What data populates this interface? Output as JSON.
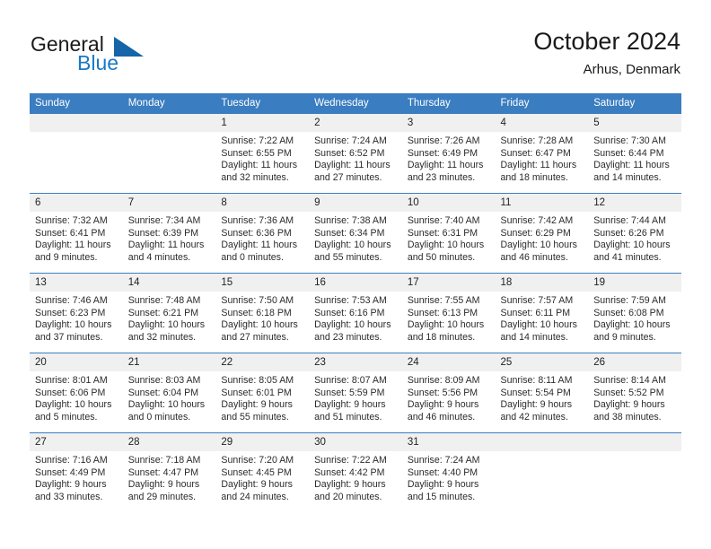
{
  "brand": {
    "name_part1": "General",
    "name_part2": "Blue",
    "accent_color": "#1a79c4",
    "triangle_color": "#1565a8"
  },
  "header": {
    "title": "October 2024",
    "subtitle": "Arhus, Denmark"
  },
  "theme": {
    "header_row_bg": "#3a7dc0",
    "day_number_bg": "#f0f0f0",
    "grid_line": "#3a7dc0",
    "text": "#222222"
  },
  "weekdays": [
    "Sunday",
    "Monday",
    "Tuesday",
    "Wednesday",
    "Thursday",
    "Friday",
    "Saturday"
  ],
  "labels": {
    "sunrise_prefix": "Sunrise:",
    "sunset_prefix": "Sunset:",
    "daylight_prefix": "Daylight:"
  },
  "weeks": [
    [
      {
        "day": "",
        "blank": true
      },
      {
        "day": "",
        "blank": true
      },
      {
        "day": "1",
        "sunrise": "Sunrise: 7:22 AM",
        "sunset": "Sunset: 6:55 PM",
        "daylight_line1": "Daylight: 11 hours",
        "daylight_line2": "and 32 minutes."
      },
      {
        "day": "2",
        "sunrise": "Sunrise: 7:24 AM",
        "sunset": "Sunset: 6:52 PM",
        "daylight_line1": "Daylight: 11 hours",
        "daylight_line2": "and 27 minutes."
      },
      {
        "day": "3",
        "sunrise": "Sunrise: 7:26 AM",
        "sunset": "Sunset: 6:49 PM",
        "daylight_line1": "Daylight: 11 hours",
        "daylight_line2": "and 23 minutes."
      },
      {
        "day": "4",
        "sunrise": "Sunrise: 7:28 AM",
        "sunset": "Sunset: 6:47 PM",
        "daylight_line1": "Daylight: 11 hours",
        "daylight_line2": "and 18 minutes."
      },
      {
        "day": "5",
        "sunrise": "Sunrise: 7:30 AM",
        "sunset": "Sunset: 6:44 PM",
        "daylight_line1": "Daylight: 11 hours",
        "daylight_line2": "and 14 minutes."
      }
    ],
    [
      {
        "day": "6",
        "sunrise": "Sunrise: 7:32 AM",
        "sunset": "Sunset: 6:41 PM",
        "daylight_line1": "Daylight: 11 hours",
        "daylight_line2": "and 9 minutes."
      },
      {
        "day": "7",
        "sunrise": "Sunrise: 7:34 AM",
        "sunset": "Sunset: 6:39 PM",
        "daylight_line1": "Daylight: 11 hours",
        "daylight_line2": "and 4 minutes."
      },
      {
        "day": "8",
        "sunrise": "Sunrise: 7:36 AM",
        "sunset": "Sunset: 6:36 PM",
        "daylight_line1": "Daylight: 11 hours",
        "daylight_line2": "and 0 minutes."
      },
      {
        "day": "9",
        "sunrise": "Sunrise: 7:38 AM",
        "sunset": "Sunset: 6:34 PM",
        "daylight_line1": "Daylight: 10 hours",
        "daylight_line2": "and 55 minutes."
      },
      {
        "day": "10",
        "sunrise": "Sunrise: 7:40 AM",
        "sunset": "Sunset: 6:31 PM",
        "daylight_line1": "Daylight: 10 hours",
        "daylight_line2": "and 50 minutes."
      },
      {
        "day": "11",
        "sunrise": "Sunrise: 7:42 AM",
        "sunset": "Sunset: 6:29 PM",
        "daylight_line1": "Daylight: 10 hours",
        "daylight_line2": "and 46 minutes."
      },
      {
        "day": "12",
        "sunrise": "Sunrise: 7:44 AM",
        "sunset": "Sunset: 6:26 PM",
        "daylight_line1": "Daylight: 10 hours",
        "daylight_line2": "and 41 minutes."
      }
    ],
    [
      {
        "day": "13",
        "sunrise": "Sunrise: 7:46 AM",
        "sunset": "Sunset: 6:23 PM",
        "daylight_line1": "Daylight: 10 hours",
        "daylight_line2": "and 37 minutes."
      },
      {
        "day": "14",
        "sunrise": "Sunrise: 7:48 AM",
        "sunset": "Sunset: 6:21 PM",
        "daylight_line1": "Daylight: 10 hours",
        "daylight_line2": "and 32 minutes."
      },
      {
        "day": "15",
        "sunrise": "Sunrise: 7:50 AM",
        "sunset": "Sunset: 6:18 PM",
        "daylight_line1": "Daylight: 10 hours",
        "daylight_line2": "and 27 minutes."
      },
      {
        "day": "16",
        "sunrise": "Sunrise: 7:53 AM",
        "sunset": "Sunset: 6:16 PM",
        "daylight_line1": "Daylight: 10 hours",
        "daylight_line2": "and 23 minutes."
      },
      {
        "day": "17",
        "sunrise": "Sunrise: 7:55 AM",
        "sunset": "Sunset: 6:13 PM",
        "daylight_line1": "Daylight: 10 hours",
        "daylight_line2": "and 18 minutes."
      },
      {
        "day": "18",
        "sunrise": "Sunrise: 7:57 AM",
        "sunset": "Sunset: 6:11 PM",
        "daylight_line1": "Daylight: 10 hours",
        "daylight_line2": "and 14 minutes."
      },
      {
        "day": "19",
        "sunrise": "Sunrise: 7:59 AM",
        "sunset": "Sunset: 6:08 PM",
        "daylight_line1": "Daylight: 10 hours",
        "daylight_line2": "and 9 minutes."
      }
    ],
    [
      {
        "day": "20",
        "sunrise": "Sunrise: 8:01 AM",
        "sunset": "Sunset: 6:06 PM",
        "daylight_line1": "Daylight: 10 hours",
        "daylight_line2": "and 5 minutes."
      },
      {
        "day": "21",
        "sunrise": "Sunrise: 8:03 AM",
        "sunset": "Sunset: 6:04 PM",
        "daylight_line1": "Daylight: 10 hours",
        "daylight_line2": "and 0 minutes."
      },
      {
        "day": "22",
        "sunrise": "Sunrise: 8:05 AM",
        "sunset": "Sunset: 6:01 PM",
        "daylight_line1": "Daylight: 9 hours",
        "daylight_line2": "and 55 minutes."
      },
      {
        "day": "23",
        "sunrise": "Sunrise: 8:07 AM",
        "sunset": "Sunset: 5:59 PM",
        "daylight_line1": "Daylight: 9 hours",
        "daylight_line2": "and 51 minutes."
      },
      {
        "day": "24",
        "sunrise": "Sunrise: 8:09 AM",
        "sunset": "Sunset: 5:56 PM",
        "daylight_line1": "Daylight: 9 hours",
        "daylight_line2": "and 46 minutes."
      },
      {
        "day": "25",
        "sunrise": "Sunrise: 8:11 AM",
        "sunset": "Sunset: 5:54 PM",
        "daylight_line1": "Daylight: 9 hours",
        "daylight_line2": "and 42 minutes."
      },
      {
        "day": "26",
        "sunrise": "Sunrise: 8:14 AM",
        "sunset": "Sunset: 5:52 PM",
        "daylight_line1": "Daylight: 9 hours",
        "daylight_line2": "and 38 minutes."
      }
    ],
    [
      {
        "day": "27",
        "sunrise": "Sunrise: 7:16 AM",
        "sunset": "Sunset: 4:49 PM",
        "daylight_line1": "Daylight: 9 hours",
        "daylight_line2": "and 33 minutes."
      },
      {
        "day": "28",
        "sunrise": "Sunrise: 7:18 AM",
        "sunset": "Sunset: 4:47 PM",
        "daylight_line1": "Daylight: 9 hours",
        "daylight_line2": "and 29 minutes."
      },
      {
        "day": "29",
        "sunrise": "Sunrise: 7:20 AM",
        "sunset": "Sunset: 4:45 PM",
        "daylight_line1": "Daylight: 9 hours",
        "daylight_line2": "and 24 minutes."
      },
      {
        "day": "30",
        "sunrise": "Sunrise: 7:22 AM",
        "sunset": "Sunset: 4:42 PM",
        "daylight_line1": "Daylight: 9 hours",
        "daylight_line2": "and 20 minutes."
      },
      {
        "day": "31",
        "sunrise": "Sunrise: 7:24 AM",
        "sunset": "Sunset: 4:40 PM",
        "daylight_line1": "Daylight: 9 hours",
        "daylight_line2": "and 15 minutes."
      },
      {
        "day": "",
        "blank": true
      },
      {
        "day": "",
        "blank": true
      }
    ]
  ]
}
